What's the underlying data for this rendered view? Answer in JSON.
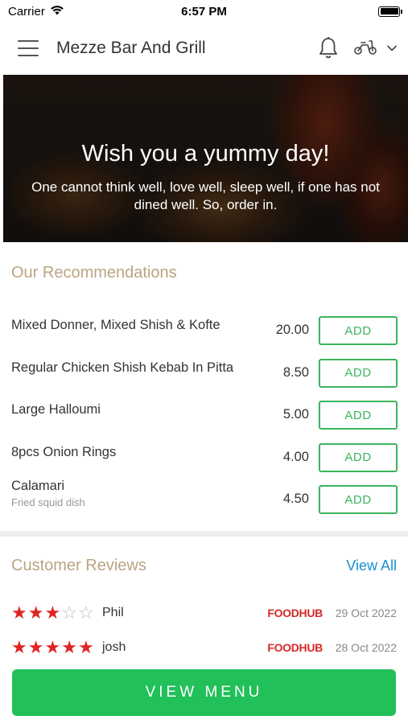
{
  "status_bar": {
    "carrier": "Carrier",
    "time": "6:57 PM"
  },
  "header": {
    "title": "Mezze Bar And Grill"
  },
  "hero": {
    "title": "Wish you a yummy day!",
    "subtitle": "One cannot think well, love well, sleep well, if one has not dined well. So, order in."
  },
  "recommendations": {
    "title": "Our Recommendations",
    "items": [
      {
        "name": "Mixed Donner, Mixed Shish & Kofte",
        "description": "",
        "price": "20.00",
        "button": "ADD"
      },
      {
        "name": "Regular Chicken Shish Kebab In Pitta",
        "description": "",
        "price": "8.50",
        "button": "ADD"
      },
      {
        "name": "Large Halloumi",
        "description": "",
        "price": "5.00",
        "button": "ADD"
      },
      {
        "name": "8pcs Onion Rings",
        "description": "",
        "price": "4.00",
        "button": "ADD"
      },
      {
        "name": "Calamari",
        "description": "Fried squid dish",
        "price": "4.50",
        "button": "ADD"
      }
    ]
  },
  "reviews": {
    "title": "Customer Reviews",
    "view_all": "View All",
    "items": [
      {
        "name": "Phil",
        "rating": 3,
        "max_rating": 5,
        "source": "FOODHUB",
        "date": "29 Oct 2022"
      },
      {
        "name": "josh",
        "rating": 5,
        "max_rating": 5,
        "source": "FOODHUB",
        "date": "28 Oct 2022"
      }
    ]
  },
  "view_menu_label": "VIEW MENU",
  "colors": {
    "accent_green": "#21c059",
    "add_green": "#3bb45d",
    "section_title": "#b9a582",
    "link_blue": "#1a8ed6",
    "star_red": "#e02424",
    "brand_red": "#d62828"
  },
  "icons": [
    "wifi-icon",
    "battery-icon",
    "menu-icon",
    "bell-icon",
    "scooter-icon",
    "chevron-down-icon",
    "star-icon"
  ]
}
